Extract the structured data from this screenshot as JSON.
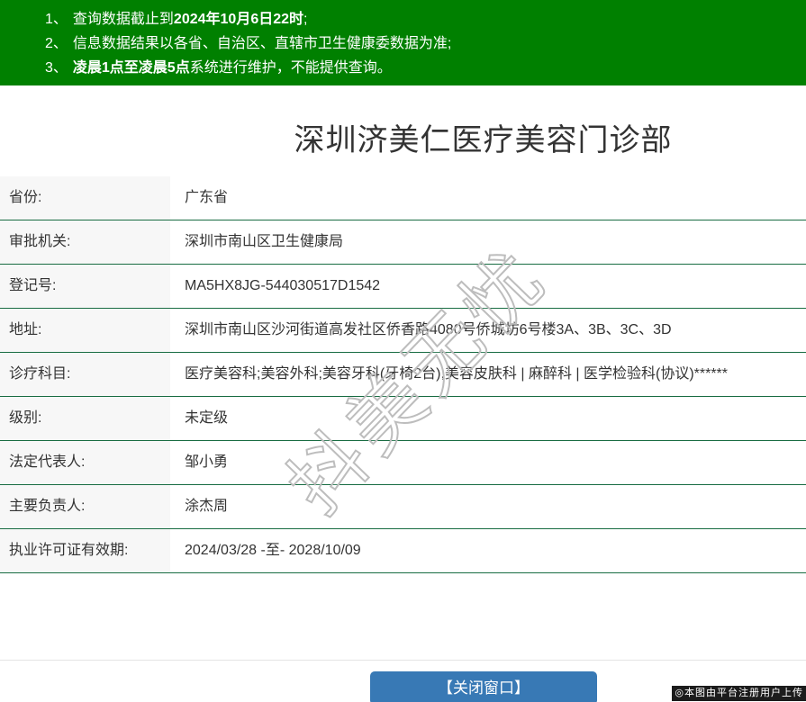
{
  "notices": {
    "items": [
      {
        "num": "1、",
        "pre": "查询数据截止到",
        "bold": "2024年10月6日22时",
        "post": ";"
      },
      {
        "num": "2、",
        "pre": "信息数据结果以各省、自治区、直辖市卫生健康委数据为准;",
        "bold": "",
        "post": ""
      },
      {
        "num": "3、",
        "pre": "",
        "bold": "凌晨1点至凌晨5点",
        "post": "系统进行维护，不能提供查询。"
      }
    ]
  },
  "title": "深圳济美仁医疗美容门诊部",
  "table": {
    "rows": [
      {
        "label": "省份:",
        "value": "广东省"
      },
      {
        "label": "审批机关:",
        "value": "深圳市南山区卫生健康局"
      },
      {
        "label": "登记号:",
        "value": "MA5HX8JG-544030517D1542"
      },
      {
        "label": "地址:",
        "value": "深圳市南山区沙河街道高发社区侨香路4080号侨城坊6号楼3A、3B、3C、3D"
      },
      {
        "label": "诊疗科目:",
        "value": "医疗美容科;美容外科;美容牙科(牙椅2台);美容皮肤科 | 麻醉科 | 医学检验科(协议)******"
      },
      {
        "label": "级别:",
        "value": "未定级"
      },
      {
        "label": "法定代表人:",
        "value": "邹小勇"
      },
      {
        "label": "主要负责人:",
        "value": "涂杰周"
      },
      {
        "label": "执业许可证有效期:",
        "value": "2024/03/28 -至- 2028/10/09"
      }
    ]
  },
  "close_button_label": "【关闭窗口】",
  "watermark_text": "抖美无忧",
  "footer_credit": "◎本图由平台注册用户上传",
  "colors": {
    "header_green": "#008000",
    "row_border_green": "#186c42",
    "button_blue": "#3879b5",
    "label_bg": "#f7f7f7"
  }
}
